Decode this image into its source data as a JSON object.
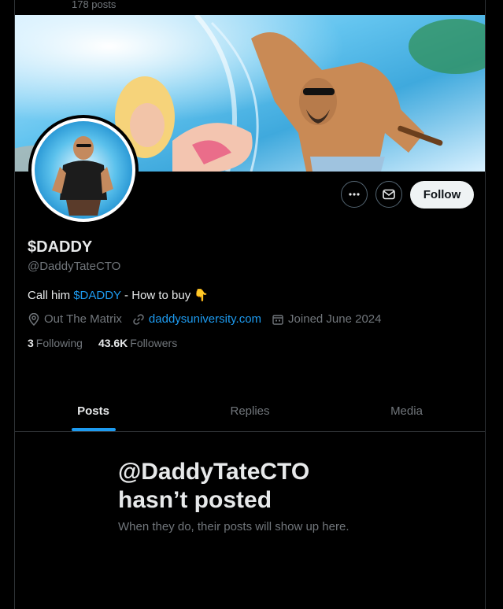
{
  "header": {
    "post_count": "178 posts"
  },
  "profile": {
    "display_name": "$DADDY",
    "handle": "@DaddyTateCTO",
    "bio_prefix": "Call him",
    "bio_link": "$DADDY",
    "bio_suffix": "- How to buy",
    "bio_emoji": "👇",
    "location": "Out The Matrix",
    "website": "daddysuniversity.com",
    "joined": "Joined June 2024",
    "following_count": "3",
    "following_label": "Following",
    "followers_count": "43.6K",
    "followers_label": "Followers"
  },
  "actions": {
    "follow_label": "Follow"
  },
  "tabs": [
    {
      "label": "Posts",
      "active": true
    },
    {
      "label": "Replies",
      "active": false
    },
    {
      "label": "Media",
      "active": false
    }
  ],
  "empty_state": {
    "title_line1": "@DaddyTateCTO",
    "title_line2": "hasn’t posted",
    "subtitle": "When they do, their posts will show up here."
  },
  "colors": {
    "accent": "#1d9bf0",
    "background": "#000000",
    "muted": "#71767b"
  },
  "icons": [
    "more-icon",
    "message-icon",
    "location-icon",
    "link-icon",
    "calendar-icon"
  ]
}
